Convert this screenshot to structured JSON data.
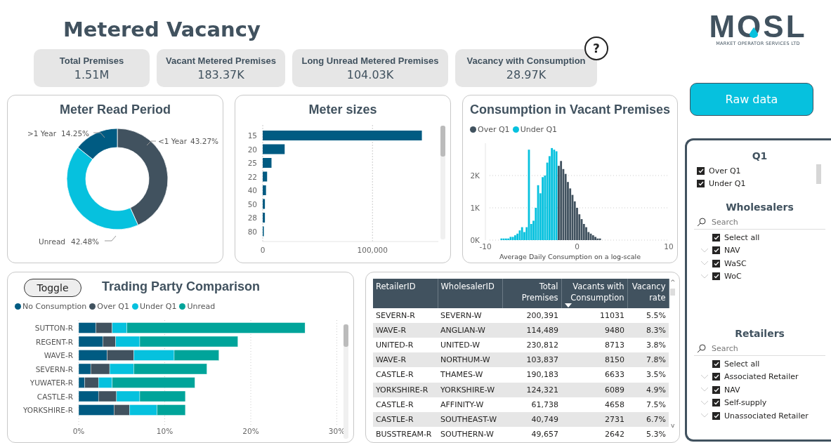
{
  "title": "Metered Vacancy",
  "kpis": [
    {
      "label": "Total Premises",
      "value": "1.51M"
    },
    {
      "label": "Vacant Metered Premises",
      "value": "183.37K"
    },
    {
      "label": "Long Unread Metered Premises",
      "value": "104.03K"
    },
    {
      "label": "Vacancy with Consumption",
      "value": "28.97K"
    }
  ],
  "help": {
    "label": "?"
  },
  "logo": {
    "name": "MOSL",
    "tagline": "MARKET OPERATOR SERVICES LTD"
  },
  "raw_data_button": "Raw data",
  "meter_read_period": {
    "title": "Meter Read Period",
    "chart_data": {
      "type": "donut",
      "categories": [
        "<1 Year",
        "Unread",
        ">1 Year"
      ],
      "values": [
        43.27,
        42.48,
        14.25
      ],
      "value_labels": [
        "43.27%",
        "42.48%",
        "14.25%"
      ],
      "colors": [
        "#41525f",
        "#06c1de",
        "#005b82"
      ]
    }
  },
  "meter_sizes": {
    "title": "Meter sizes",
    "chart_data": {
      "type": "bar",
      "orientation": "horizontal",
      "categories": [
        "15",
        "20",
        "25",
        "22",
        "40",
        "50",
        "28",
        "80"
      ],
      "values": [
        145000,
        20000,
        8000,
        4000,
        3000,
        2000,
        2000,
        1000
      ],
      "grid": true,
      "xlim": [
        0,
        160000
      ],
      "xticks": [
        0,
        {
          "value": 100000,
          "label": "100,000"
        }
      ]
    }
  },
  "consumption": {
    "title": "Consumption in Vacant Premises",
    "chart_data": {
      "type": "bar",
      "xlabel": "Average Daily Consumption on a log-scale",
      "x": [
        -9,
        -8.75,
        -8.5,
        -8.25,
        -8,
        -7.75,
        -7.5,
        -7.25,
        -7,
        -6.75,
        -6.5,
        -6.25,
        -6,
        -5.75,
        -5.5,
        -5.25,
        -5,
        -4.75,
        -4.5,
        -4.25,
        -4,
        -3.75,
        -3.5,
        -3.25,
        -3,
        -2.75,
        -2.5,
        -2.25,
        -2,
        -1.75,
        -1.5,
        -1.25,
        -1,
        -0.75,
        -0.5,
        -0.25,
        0,
        0.25,
        0.5,
        0.75,
        1,
        1.25,
        1.5,
        1.75,
        2,
        2.25,
        2.5,
        2.75,
        3,
        3.25,
        3.5,
        3.75,
        4,
        4.25
      ],
      "series": [
        {
          "name": "Over Q1",
          "color": "#41525f",
          "values": [
            0,
            0,
            0,
            0,
            0,
            0,
            0,
            0,
            0,
            0,
            0,
            0,
            0,
            0,
            0,
            0,
            0,
            0,
            0,
            0,
            0,
            0,
            0,
            0,
            0,
            0,
            0,
            0,
            2300,
            2450,
            2200,
            2050,
            1800,
            1600,
            1400,
            1200,
            1000,
            800,
            650,
            500,
            400,
            250,
            200,
            150,
            100,
            50,
            50,
            0,
            0,
            0,
            0,
            0,
            0,
            0
          ]
        },
        {
          "name": "Under Q1",
          "color": "#06c1de",
          "values": [
            0,
            0,
            0,
            50,
            50,
            50,
            50,
            100,
            100,
            150,
            200,
            300,
            400,
            250,
            400,
            2800,
            500,
            600,
            1000,
            1700,
            1450,
            1950,
            2000,
            2400,
            2600,
            2850,
            2800,
            2750,
            0,
            0,
            0,
            0,
            0,
            0,
            0,
            0,
            0,
            0,
            0,
            0,
            0,
            0,
            0,
            0,
            0,
            0,
            0,
            0,
            0,
            0,
            0,
            0,
            0,
            0
          ]
        }
      ],
      "xlim": [
        -10,
        10
      ],
      "ylim": [
        0,
        3000
      ],
      "grid": true,
      "xticks": [
        -10,
        0,
        10
      ],
      "yticks": [
        {
          "value": 0,
          "label": "0K"
        },
        {
          "value": 1000,
          "label": "1K"
        },
        {
          "value": 2000,
          "label": "2K"
        }
      ]
    }
  },
  "trading_party": {
    "title": "Trading Party Comparison",
    "toggle": "Toggle",
    "chart_data": {
      "type": "bar",
      "orientation": "horizontal",
      "stacked": true,
      "categories": [
        "SUTTON-R",
        "REGENT-R",
        "WAVE-R",
        "SEVERN-R",
        "YUWATER-R",
        "CASTLE-R",
        "YORKSHIRE-R"
      ],
      "series": [
        {
          "name": "No Consumption",
          "color": "#005b82",
          "values": [
            2.0,
            2.8,
            3.3,
            1.4,
            0.7,
            2.3,
            4.1
          ]
        },
        {
          "name": "Over Q1",
          "color": "#41525f",
          "values": [
            1.9,
            1.5,
            3.1,
            2.2,
            1.6,
            2.1,
            1.8
          ]
        },
        {
          "name": "Under Q1",
          "color": "#06c1de",
          "values": [
            1.7,
            2.8,
            4.7,
            2.8,
            1.6,
            2.7,
            3.2
          ]
        },
        {
          "name": "Unread",
          "color": "#00a49a",
          "values": [
            20.7,
            11.4,
            5.2,
            8.5,
            9.6,
            5.3,
            3.3
          ]
        }
      ],
      "grid": true,
      "xlim": [
        0,
        30
      ],
      "xticks": [
        {
          "value": 0,
          "label": "0%"
        },
        {
          "value": 10,
          "label": "10%"
        },
        {
          "value": 20,
          "label": "20%"
        },
        {
          "value": 30,
          "label": "30%"
        }
      ]
    }
  },
  "table": {
    "columns": [
      {
        "label": "RetailerID",
        "sorted": false
      },
      {
        "label": "WholesalerID",
        "sorted": false
      },
      {
        "label": "Total Premises",
        "sorted": false
      },
      {
        "label": "Vacants with Consumption",
        "sorted": true
      },
      {
        "label": "Vacancy rate",
        "sorted": false
      }
    ],
    "scroll_up": "^",
    "scroll_down": "v",
    "rows": [
      [
        "SEVERN-R",
        "SEVERN-W",
        "200,391",
        "11031",
        "5.5%"
      ],
      [
        "WAVE-R",
        "ANGLIAN-W",
        "114,489",
        "9480",
        "8.3%"
      ],
      [
        "UNITED-R",
        "UNITED-W",
        "230,812",
        "8713",
        "3.8%"
      ],
      [
        "WAVE-R",
        "NORTHUM-W",
        "103,837",
        "8150",
        "7.8%"
      ],
      [
        "CASTLE-R",
        "THAMES-W",
        "190,183",
        "6633",
        "3.5%"
      ],
      [
        "YORKSHIRE-R",
        "YORKSHIRE-W",
        "124,321",
        "6089",
        "4.9%"
      ],
      [
        "CASTLE-R",
        "AFFINITY-W",
        "61,738",
        "4658",
        "7.5%"
      ],
      [
        "CASTLE-R",
        "SOUTHEAST-W",
        "40,749",
        "2731",
        "6.7%"
      ],
      [
        "BUSSTREAM-R",
        "SOUTHERN-W",
        "49,657",
        "2642",
        "5.3%"
      ]
    ]
  },
  "slicers": [
    {
      "title": "Q1",
      "items": [
        {
          "label": "Over Q1",
          "checked": true
        },
        {
          "label": "Under Q1",
          "checked": true
        }
      ]
    },
    {
      "title": "Wholesalers",
      "search": {
        "placeholder": "Search"
      },
      "items": [
        {
          "label": "Select all",
          "checked": true,
          "expandable": false
        },
        {
          "label": "NAV",
          "checked": true,
          "expandable": true
        },
        {
          "label": "WaSC",
          "checked": true,
          "expandable": true
        },
        {
          "label": "WoC",
          "checked": true,
          "expandable": true
        }
      ]
    },
    {
      "title": "Retailers",
      "search": {
        "placeholder": "Search"
      },
      "items": [
        {
          "label": "Select all",
          "checked": true,
          "expandable": false
        },
        {
          "label": "Associated Retailer",
          "checked": true,
          "expandable": true
        },
        {
          "label": "NAV",
          "checked": true,
          "expandable": true
        },
        {
          "label": "Self-supply",
          "checked": true,
          "expandable": true
        },
        {
          "label": "Unassociated Retailer",
          "checked": true,
          "expandable": true
        }
      ]
    }
  ]
}
